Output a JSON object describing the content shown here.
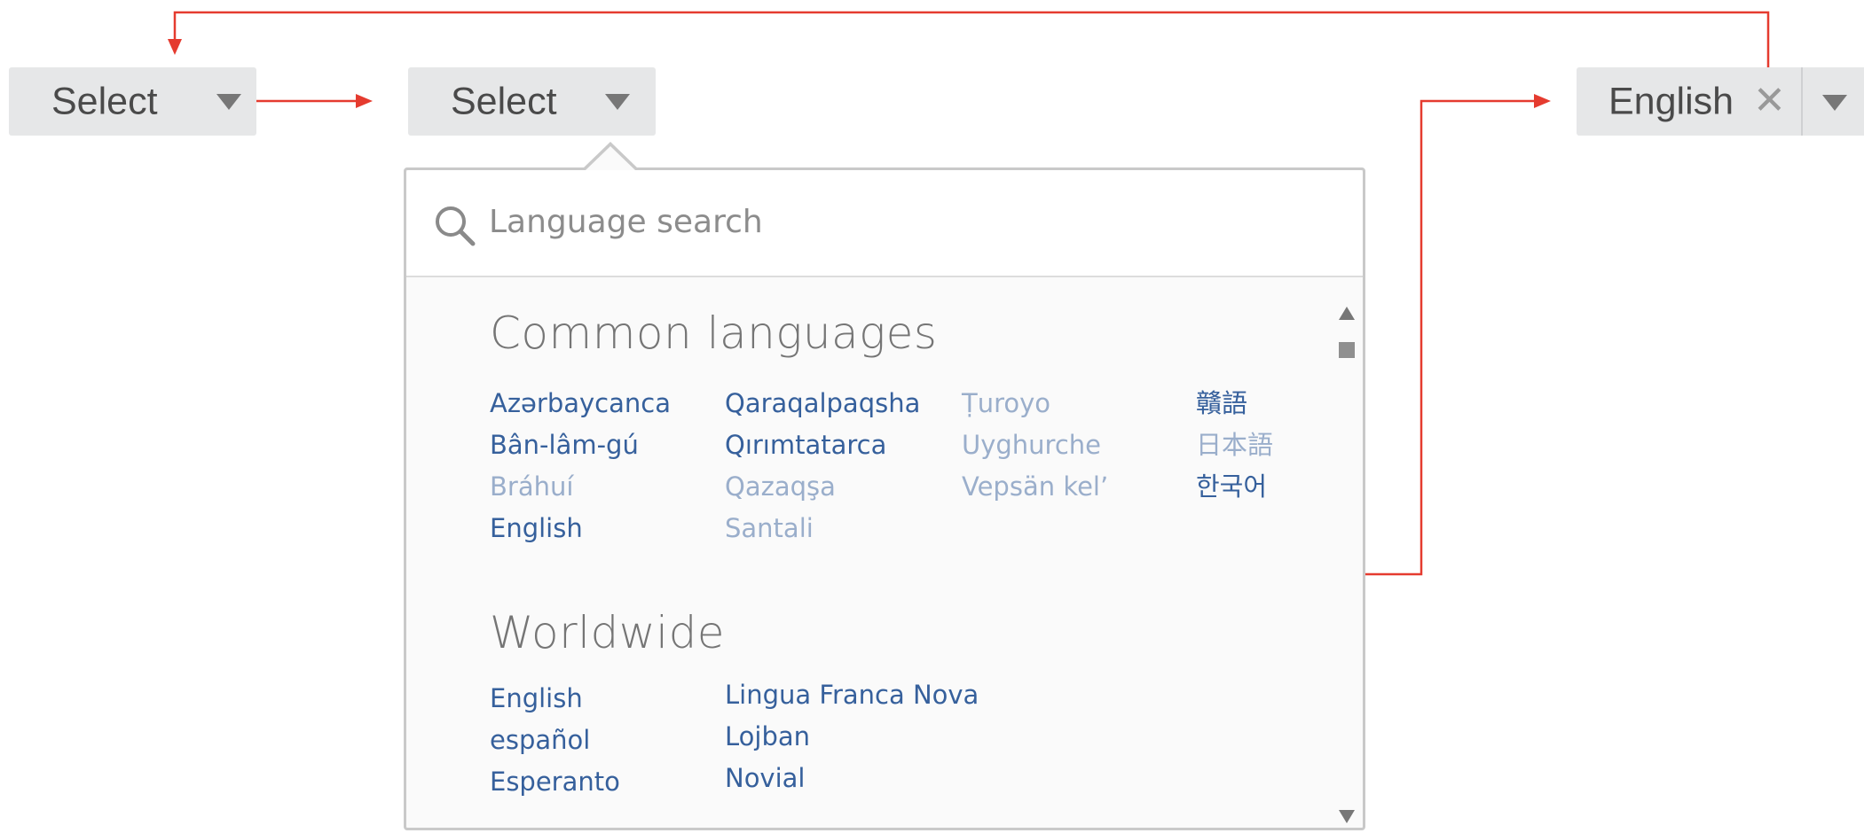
{
  "selects": {
    "first": {
      "label": "Select"
    },
    "second": {
      "label": "Select"
    },
    "result": {
      "label": "English",
      "clear_glyph": "✕"
    }
  },
  "search": {
    "placeholder": "Language search",
    "value": ""
  },
  "common": {
    "title": "Common languages",
    "columns": [
      [
        {
          "name": "Azərbaycanca",
          "enabled": true
        },
        {
          "name": "Bân-lâm-gú",
          "enabled": true
        },
        {
          "name": "Bráhuí",
          "enabled": false
        },
        {
          "name": "English",
          "enabled": true
        }
      ],
      [
        {
          "name": "Qaraqalpaqsha",
          "enabled": true
        },
        {
          "name": "Qırımtatarca",
          "enabled": true
        },
        {
          "name": "Qazaqşa",
          "enabled": false
        },
        {
          "name": "Santali",
          "enabled": false
        }
      ],
      [
        {
          "name": "Ṭuroyo",
          "enabled": false
        },
        {
          "name": "Uyghurche",
          "enabled": false
        },
        {
          "name": "Vepsän kel’",
          "enabled": false
        }
      ],
      [
        {
          "name": "贛語",
          "enabled": true
        },
        {
          "name": "日本語",
          "enabled": false
        },
        {
          "name": "한국어",
          "enabled": true
        }
      ]
    ]
  },
  "worldwide": {
    "title": "Worldwide",
    "columns": [
      [
        {
          "name": "English",
          "enabled": true
        },
        {
          "name": "español",
          "enabled": true
        },
        {
          "name": "Esperanto",
          "enabled": true
        }
      ],
      [
        {
          "name": "Lingua Franca Nova",
          "enabled": true
        },
        {
          "name": "Lojban",
          "enabled": true
        },
        {
          "name": "Novial",
          "enabled": true
        }
      ]
    ]
  },
  "icons": [
    "search-icon",
    "chevron-down-icon",
    "close-icon",
    "scroll-up-icon",
    "scroll-down-icon"
  ],
  "colors": {
    "connector": "#e53b2f",
    "link": "#36609c",
    "link_disabled": "#9aaecb",
    "button_bg": "#e6e7e8"
  }
}
